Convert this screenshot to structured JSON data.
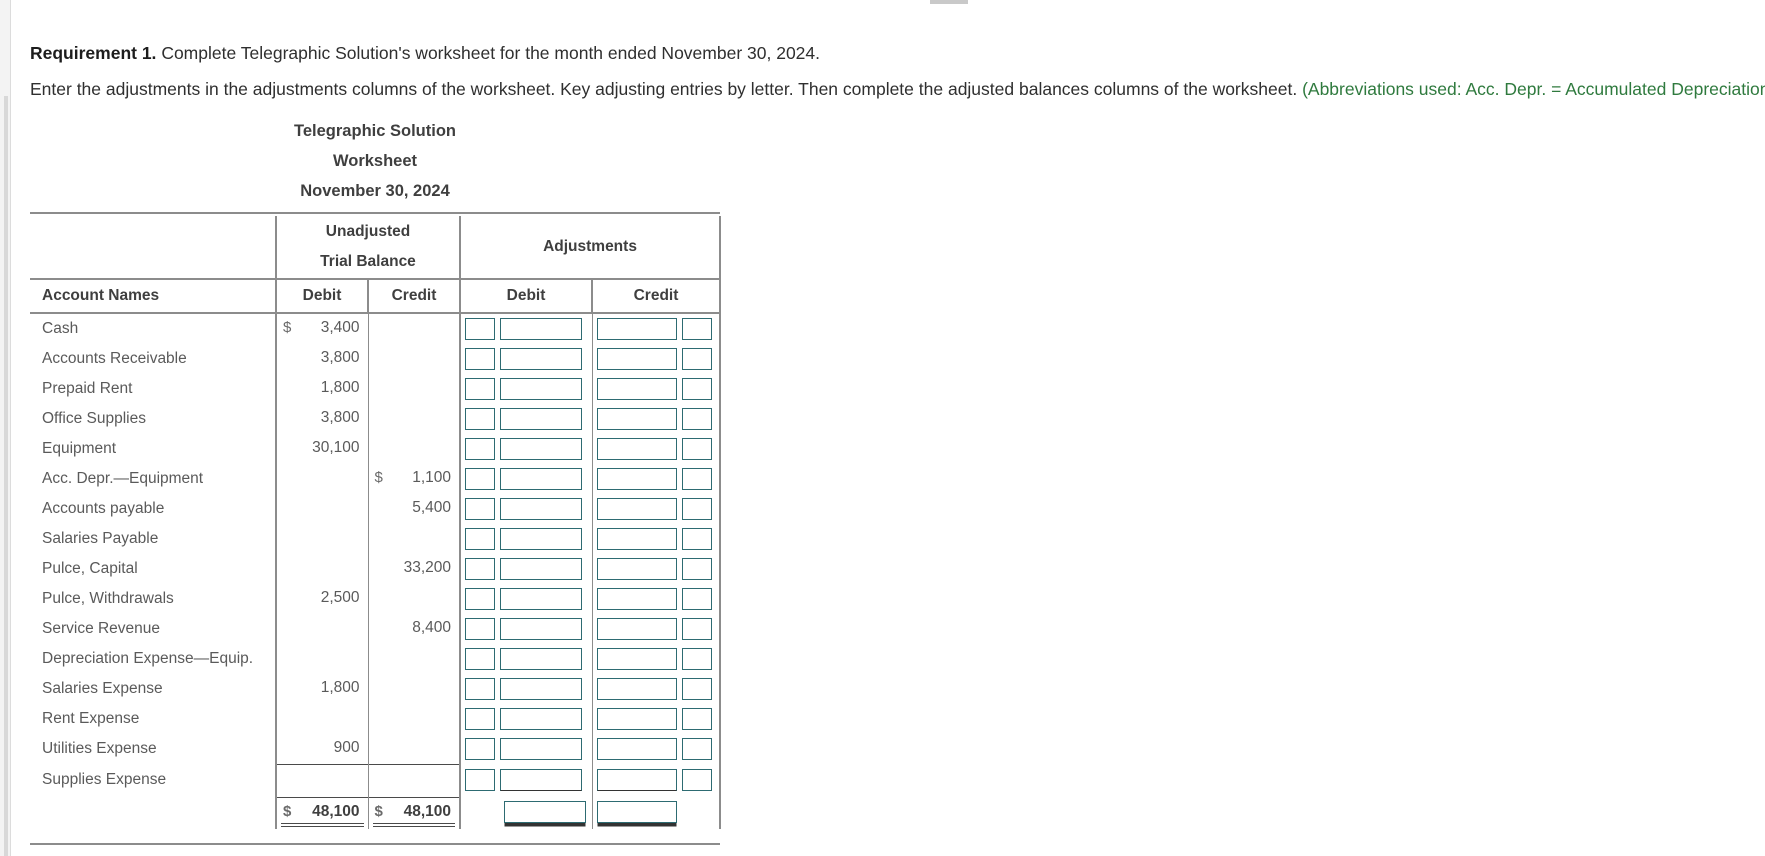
{
  "requirement": {
    "label": "Requirement 1.",
    "line1": "Complete Telegraphic Solution's worksheet for the month ended November 30, 2024.",
    "line2_black": "Enter the adjustments in the adjustments columns of the worksheet. Key adjusting entries by letter. Then complete the adjusted balances columns of the worksheet.",
    "line2_green": "(Abbreviations used: Acc. Depr. = Accumulated Depreciation; Equip. = Equipment.)"
  },
  "worksheet": {
    "company": "Telegraphic Solution",
    "title": "Worksheet",
    "date": "November 30, 2024",
    "groups": {
      "unadjusted_line1": "Unadjusted",
      "unadjusted_line2": "Trial Balance",
      "adjustments": "Adjustments"
    },
    "columns": {
      "account_names": "Account Names",
      "tb_debit": "Debit",
      "tb_credit": "Credit",
      "adj_debit": "Debit",
      "adj_credit": "Credit"
    },
    "rows": [
      {
        "account": "Cash",
        "tb_debit": "3,400",
        "tb_debit_sym": "$",
        "tb_credit": "",
        "tb_credit_sym": ""
      },
      {
        "account": "Accounts Receivable",
        "tb_debit": "3,800",
        "tb_debit_sym": "",
        "tb_credit": "",
        "tb_credit_sym": ""
      },
      {
        "account": "Prepaid Rent",
        "tb_debit": "1,800",
        "tb_debit_sym": "",
        "tb_credit": "",
        "tb_credit_sym": ""
      },
      {
        "account": "Office Supplies",
        "tb_debit": "3,800",
        "tb_debit_sym": "",
        "tb_credit": "",
        "tb_credit_sym": ""
      },
      {
        "account": "Equipment",
        "tb_debit": "30,100",
        "tb_debit_sym": "",
        "tb_credit": "",
        "tb_credit_sym": ""
      },
      {
        "account": "Acc. Depr.—Equipment",
        "tb_debit": "",
        "tb_debit_sym": "",
        "tb_credit": "1,100",
        "tb_credit_sym": "$"
      },
      {
        "account": "Accounts payable",
        "tb_debit": "",
        "tb_debit_sym": "",
        "tb_credit": "5,400",
        "tb_credit_sym": ""
      },
      {
        "account": "Salaries Payable",
        "tb_debit": "",
        "tb_debit_sym": "",
        "tb_credit": "",
        "tb_credit_sym": ""
      },
      {
        "account": "Pulce, Capital",
        "tb_debit": "",
        "tb_debit_sym": "",
        "tb_credit": "33,200",
        "tb_credit_sym": ""
      },
      {
        "account": "Pulce, Withdrawals",
        "tb_debit": "2,500",
        "tb_debit_sym": "",
        "tb_credit": "",
        "tb_credit_sym": ""
      },
      {
        "account": "Service Revenue",
        "tb_debit": "",
        "tb_debit_sym": "",
        "tb_credit": "8,400",
        "tb_credit_sym": ""
      },
      {
        "account": "Depreciation Expense—Equip.",
        "tb_debit": "",
        "tb_debit_sym": "",
        "tb_credit": "",
        "tb_credit_sym": ""
      },
      {
        "account": "Salaries Expense",
        "tb_debit": "1,800",
        "tb_debit_sym": "",
        "tb_credit": "",
        "tb_credit_sym": ""
      },
      {
        "account": "Rent Expense",
        "tb_debit": "",
        "tb_debit_sym": "",
        "tb_credit": "",
        "tb_credit_sym": ""
      },
      {
        "account": "Utilities Expense",
        "tb_debit": "900",
        "tb_debit_sym": "",
        "tb_credit": "",
        "tb_credit_sym": ""
      },
      {
        "account": "Supplies Expense",
        "tb_debit": "",
        "tb_debit_sym": "",
        "tb_credit": "",
        "tb_credit_sym": ""
      }
    ],
    "totals": {
      "account": "",
      "tb_debit_sym": "$",
      "tb_debit": "48,100",
      "tb_credit_sym": "$",
      "tb_credit": "48,100",
      "adj_debit": "",
      "adj_credit": ""
    }
  },
  "colors": {
    "green_note": "#2f7a3e",
    "input_border": "#2d6b72",
    "rule": "#8c8c8c"
  }
}
